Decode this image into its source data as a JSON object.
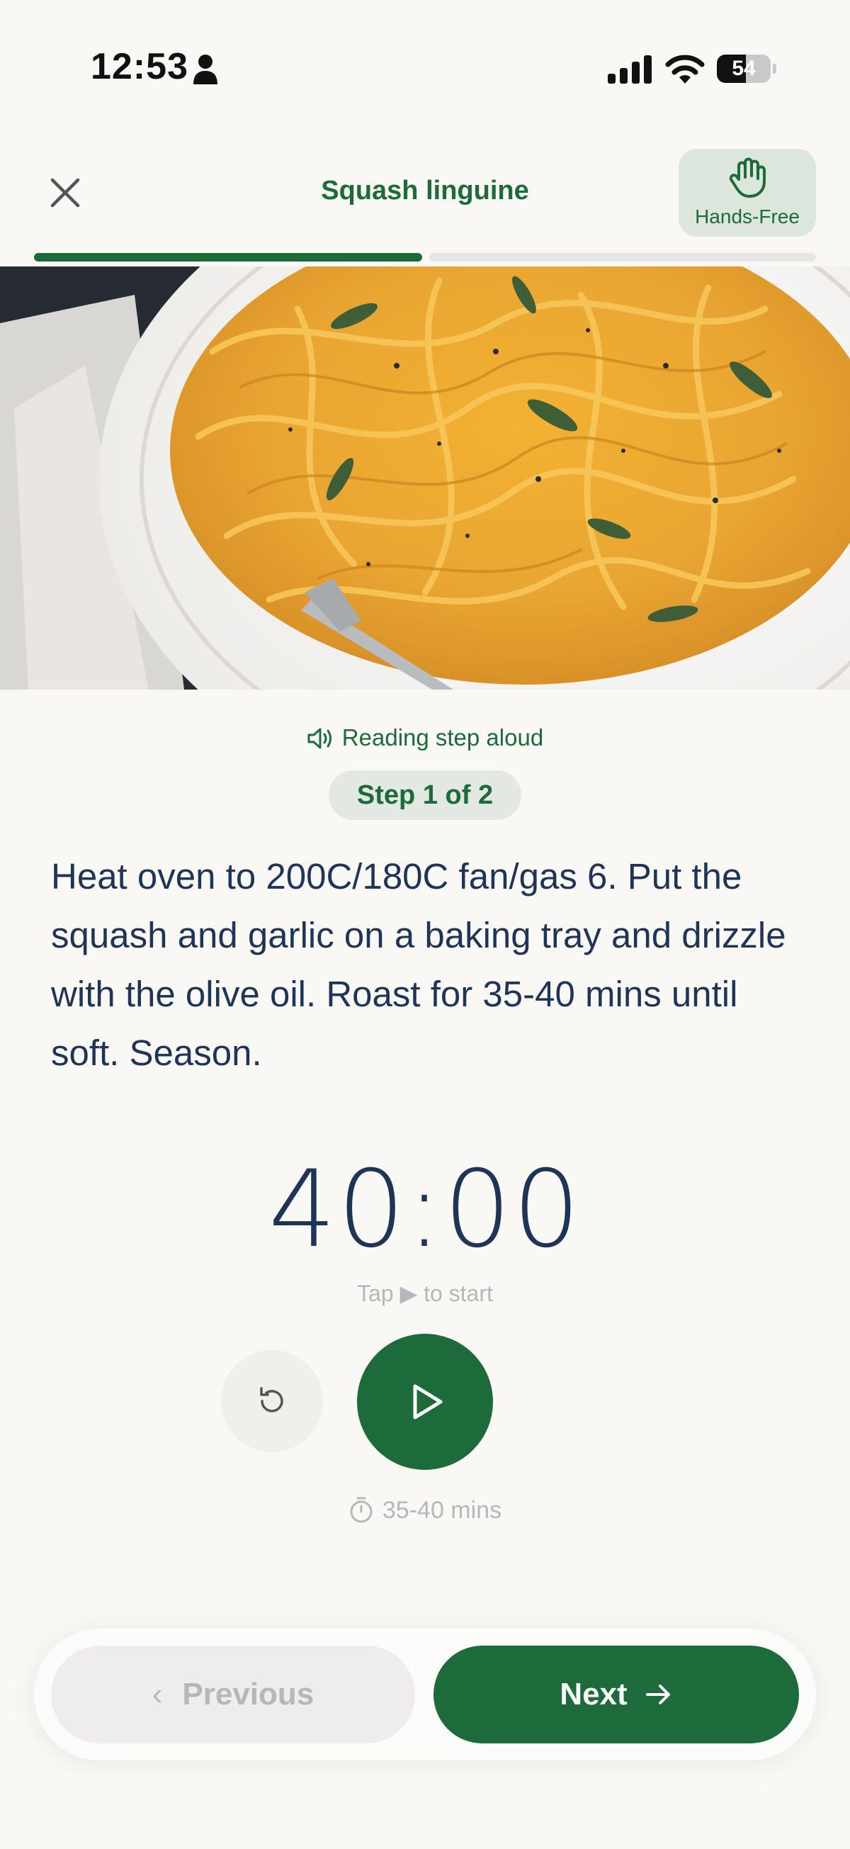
{
  "status_bar": {
    "time": "12:53",
    "battery": "54",
    "battery_level": 0.54
  },
  "header": {
    "title": "Squash linguine",
    "hands_free_label": "Hands-Free"
  },
  "progress": {
    "current_step": 1,
    "total_steps": 2
  },
  "step": {
    "reading_label": "Reading step aloud",
    "badge": "Step 1 of 2",
    "instruction": "Heat oven to 200C/180C fan/gas 6. Put the squash and garlic on a baking tray and drizzle with the olive oil. Roast for 35-40 mins until soft. Season."
  },
  "timer": {
    "display": "40:00",
    "hint": "Tap ▶ to start",
    "duration": "35-40 mins"
  },
  "nav": {
    "previous_label": "Previous",
    "next_label": "Next"
  },
  "colors": {
    "accent": "#1d6a3a",
    "text": "#1f3557",
    "muted": "#b5b7bb",
    "background": "#f9f8f5"
  }
}
